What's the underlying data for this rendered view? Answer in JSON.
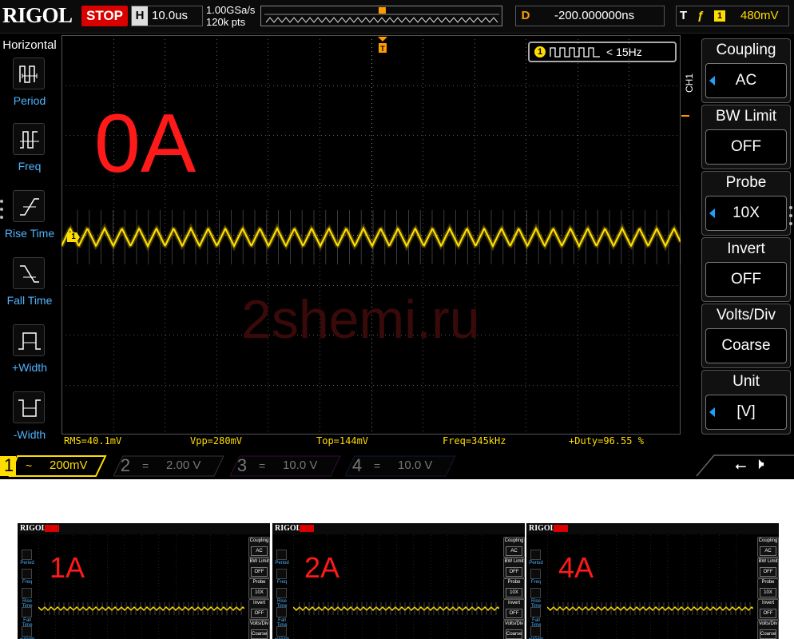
{
  "topbar": {
    "logo": "RIGOL",
    "run_state": "STOP",
    "horizontal_label": "H",
    "timebase": "10.0us",
    "sample_rate": "1.00GSa/s",
    "memory_depth": "120k pts",
    "delay_label": "D",
    "delay_value": "-200.000000ns",
    "trigger_label": "T",
    "trigger_source": "1",
    "trigger_level": "480mV"
  },
  "left_menu": {
    "title": "Horizontal",
    "items": [
      {
        "label": "Period",
        "icon": "period-icon"
      },
      {
        "label": "Freq",
        "icon": "freq-icon"
      },
      {
        "label": "Rise Time",
        "icon": "rise-time-icon"
      },
      {
        "label": "Fall Time",
        "icon": "fall-time-icon"
      },
      {
        "label": "+Width",
        "icon": "pos-width-icon"
      },
      {
        "label": "-Width",
        "icon": "neg-width-icon"
      }
    ]
  },
  "screen": {
    "freq_counter_channel": "1",
    "freq_counter_value": "< 15Hz",
    "overlay_label": "0A",
    "watermark": "2shemi.ru",
    "channel_marker": "1"
  },
  "measurements": {
    "rms": "RMS=40.1mV",
    "vpp": "Vpp=280mV",
    "top": "Top=144mV",
    "freq": "Freq=345kHz",
    "duty": "+Duty=96.55 %"
  },
  "right_menu": {
    "channel_tag": "CH1",
    "items": [
      {
        "title": "Coupling",
        "value": "AC",
        "has_arrow": true
      },
      {
        "title": "BW Limit",
        "value": "OFF",
        "has_arrow": false
      },
      {
        "title": "Probe",
        "value": "10X",
        "has_arrow": true
      },
      {
        "title": "Invert",
        "value": "OFF",
        "has_arrow": false
      },
      {
        "title": "Volts/Div",
        "value": "Coarse",
        "has_arrow": false
      },
      {
        "title": "Unit",
        "value": "[V]",
        "has_arrow": true
      }
    ]
  },
  "bottom_bar": {
    "channels": [
      {
        "num": "1",
        "coupling": "~",
        "scale": "200mV",
        "active": true,
        "color": "#ffdd00"
      },
      {
        "num": "2",
        "coupling": "=",
        "scale": "2.00 V",
        "active": false,
        "color": "#00c8ff"
      },
      {
        "num": "3",
        "coupling": "=",
        "scale": "10.0 V",
        "active": false,
        "color": "#ff40ff"
      },
      {
        "num": "4",
        "coupling": "=",
        "scale": "10.0 V",
        "active": false,
        "color": "#3080ff"
      }
    ]
  },
  "thumbnails": [
    {
      "label": "1A"
    },
    {
      "label": "2A"
    },
    {
      "label": "4A"
    }
  ],
  "colors": {
    "trace": "#ffdd00",
    "overlay": "#ff1a1a",
    "menu_label": "#4fb4ff",
    "stop": "#d90000"
  }
}
